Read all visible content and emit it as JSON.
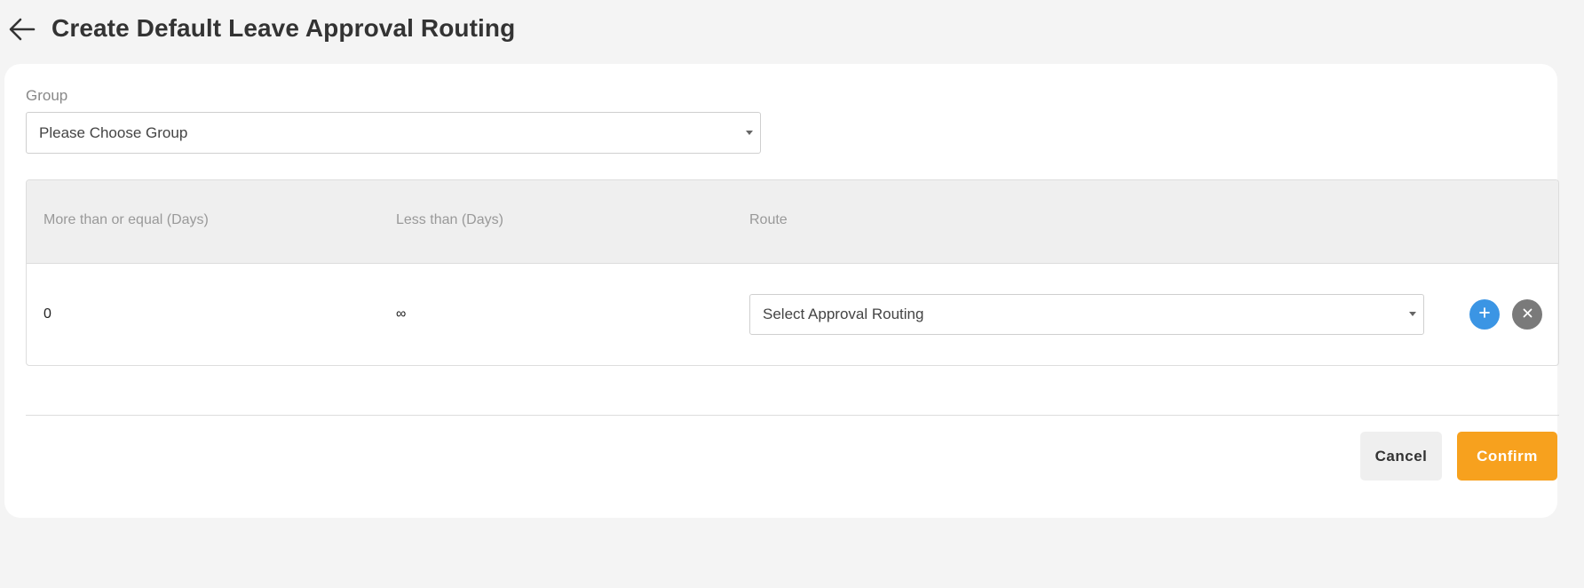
{
  "header": {
    "title": "Create Default Leave Approval Routing"
  },
  "form": {
    "group_label": "Group",
    "group_select_value": "Please Choose Group"
  },
  "table": {
    "columns": [
      "More than or equal (Days)",
      "Less than (Days)",
      "Route"
    ],
    "rows": [
      {
        "more_than_or_equal": "0",
        "less_than": "∞",
        "route_select_value": "Select Approval Routing"
      }
    ]
  },
  "footer": {
    "cancel_label": "Cancel",
    "confirm_label": "Confirm"
  },
  "colors": {
    "accent": "#f7a11e",
    "add": "#3b95e4",
    "remove": "#7a7a7a",
    "background": "#f4f4f4"
  },
  "icons": {
    "back": "arrow-left-icon",
    "add": "plus-icon",
    "remove": "close-icon",
    "caret": "caret-down-icon"
  }
}
